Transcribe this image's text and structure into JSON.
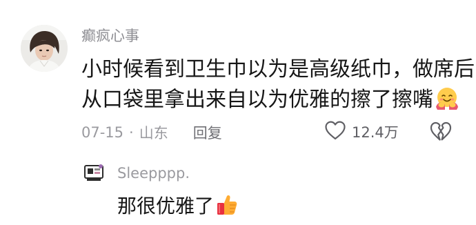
{
  "comment": {
    "username": "癫疯心事",
    "text_lines": [
      "小时候看到卫生巾以为是高级纸巾，做席后",
      "从口袋里拿出来自以为优雅的擦了擦嘴"
    ],
    "text_emoji": "hugging-face-emoji",
    "date": "07-15",
    "separator": "·",
    "location": "山东",
    "reply_label": "回复",
    "like_count": "12.4万",
    "like_icon": "heart-outline-icon",
    "dislike_icon": "broken-heart-icon"
  },
  "reply": {
    "username": "Sleepppp.",
    "text": "那很优雅了",
    "text_emoji": "thumbs-up-emoji"
  },
  "colors": {
    "primary_text": "#161616",
    "secondary_text": "#9a9a9f",
    "icon_gray": "#5f5f64"
  }
}
